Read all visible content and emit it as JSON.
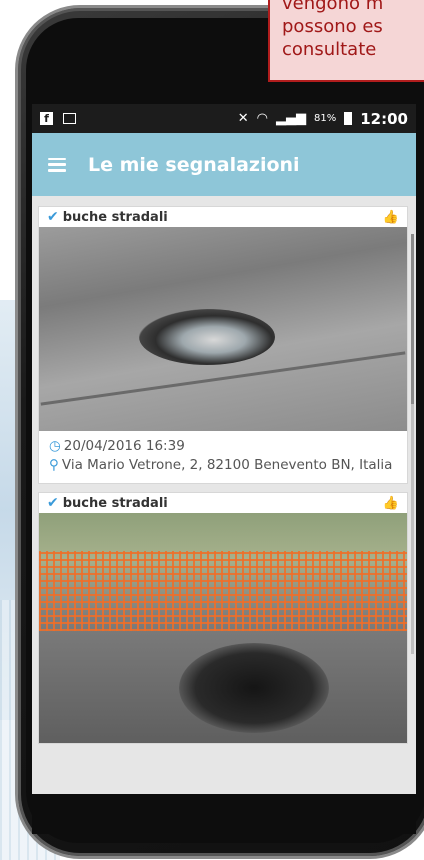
{
  "callout": {
    "line1": "vengono m",
    "line2": "possono es",
    "line3": "consultate"
  },
  "statusbar": {
    "fb_icon": "f",
    "battery_percent": "81%",
    "time": "12:00"
  },
  "appbar": {
    "title": "Le mie segnalazioni"
  },
  "reports": [
    {
      "category": "buche stradali",
      "datetime": "20/04/2016 16:39",
      "address": "Via Mario Vetrone, 2, 82100 Benevento BN, Italia"
    },
    {
      "category": "buche stradali"
    }
  ],
  "icons": {
    "check": "✔",
    "like": "👍",
    "clock": "◷",
    "pin": "⚲"
  }
}
